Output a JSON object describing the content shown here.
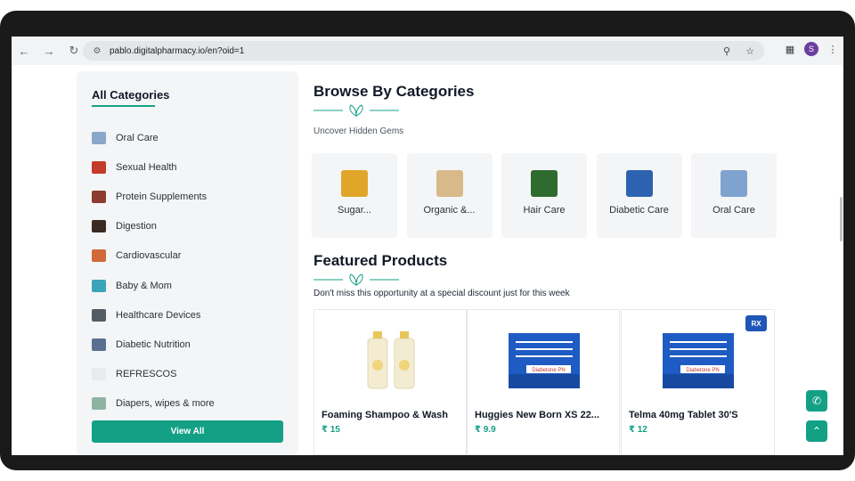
{
  "browser": {
    "url": "pablo.digitalpharmacy.io/en?oid=1",
    "profile_initial": "S",
    "icons": [
      "back-arrow-icon",
      "forward-arrow-icon",
      "reload-icon",
      "site-settings-icon",
      "location-icon",
      "star-icon",
      "extensions-icon",
      "menu-dots-icon"
    ]
  },
  "sidebar": {
    "title": "All Categories",
    "items": [
      {
        "label": "Oral Care",
        "color": "#8aa7c9"
      },
      {
        "label": "Sexual Health",
        "color": "#c43a2b"
      },
      {
        "label": "Protein Supplements",
        "color": "#8c3b2f"
      },
      {
        "label": "Digestion",
        "color": "#3b2a22"
      },
      {
        "label": "Cardiovascular",
        "color": "#d06a3a"
      },
      {
        "label": "Baby & Mom",
        "color": "#3aa5b8"
      },
      {
        "label": "Healthcare Devices",
        "color": "#555b63"
      },
      {
        "label": "Diabetic Nutrition",
        "color": "#5b6f91"
      },
      {
        "label": "REFRESCOS",
        "color": "#e9eaec"
      },
      {
        "label": "Diapers, wipes & more",
        "color": "#8fb3a3"
      }
    ],
    "view_all": "View All"
  },
  "browse": {
    "title": "Browse By Categories",
    "subtitle": "Uncover Hidden Gems",
    "cards": [
      {
        "label": "Sugar...",
        "color": "#e0a62a"
      },
      {
        "label": "Organic &...",
        "color": "#d7b98a"
      },
      {
        "label": "Hair Care",
        "color": "#2f6b2f"
      },
      {
        "label": "Diabetic Care",
        "color": "#2c62b0"
      },
      {
        "label": "Oral Care",
        "color": "#7fa2cf"
      }
    ]
  },
  "featured": {
    "title": "Featured Products",
    "subtitle": "Don't miss this opportunity at a special discount just for this week",
    "products": [
      {
        "name": "Foaming Shampoo & Wash",
        "price": "₹ 15",
        "badge": ""
      },
      {
        "name": "Huggies New Born XS 22...",
        "price": "₹ 9.9",
        "badge": ""
      },
      {
        "name": "Telma 40mg Tablet 30'S",
        "price": "₹ 12",
        "badge": "RX"
      }
    ],
    "box_text": "Diabetone PN"
  },
  "colors": {
    "accent": "#14a085",
    "rx": "#1f56b8"
  }
}
